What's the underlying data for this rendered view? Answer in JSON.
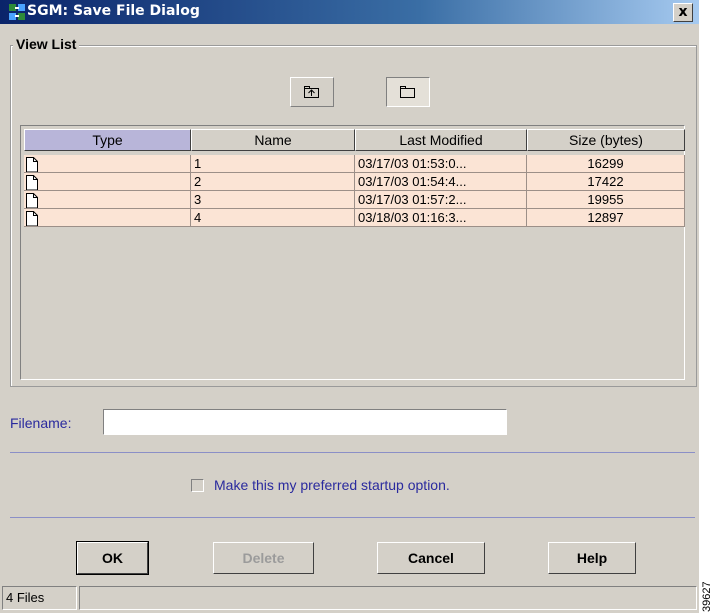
{
  "window": {
    "title": "SGM: Save File Dialog",
    "close_label": "x"
  },
  "view_list": {
    "title": "View List",
    "toolbar": [
      {
        "icon": "up-one-level-icon",
        "pressed": false
      },
      {
        "icon": "list-view-icon",
        "pressed": true
      }
    ]
  },
  "table": {
    "columns": [
      "Type",
      "Name",
      "Last Modified",
      "Size (bytes)"
    ],
    "rows": [
      {
        "icon": "document-icon",
        "name": "1",
        "modified": "03/17/03  01:53:0...",
        "size": "16299"
      },
      {
        "icon": "document-icon",
        "name": "2",
        "modified": "03/17/03  01:54:4...",
        "size": "17422"
      },
      {
        "icon": "document-icon",
        "name": "3",
        "modified": "03/17/03  01:57:2...",
        "size": "19955"
      },
      {
        "icon": "document-icon",
        "name": "4",
        "modified": "03/18/03  01:16:3...",
        "size": "12897"
      }
    ]
  },
  "filename": {
    "label": "Filename:",
    "value": "",
    "placeholder": ""
  },
  "startup_option": {
    "label": "Make this my preferred startup option.",
    "checked": false
  },
  "buttons": {
    "ok": "OK",
    "delete": "Delete",
    "cancel": "Cancel",
    "help": "Help"
  },
  "status": {
    "count": "4 Files"
  },
  "side_code": "39627",
  "colors": {
    "title_start": "#0a246a",
    "row_background": "#fbe4d5",
    "selected_header": "#b8b5d9",
    "label_blue": "#2a2a9e",
    "separator": "#8b8fc7"
  }
}
